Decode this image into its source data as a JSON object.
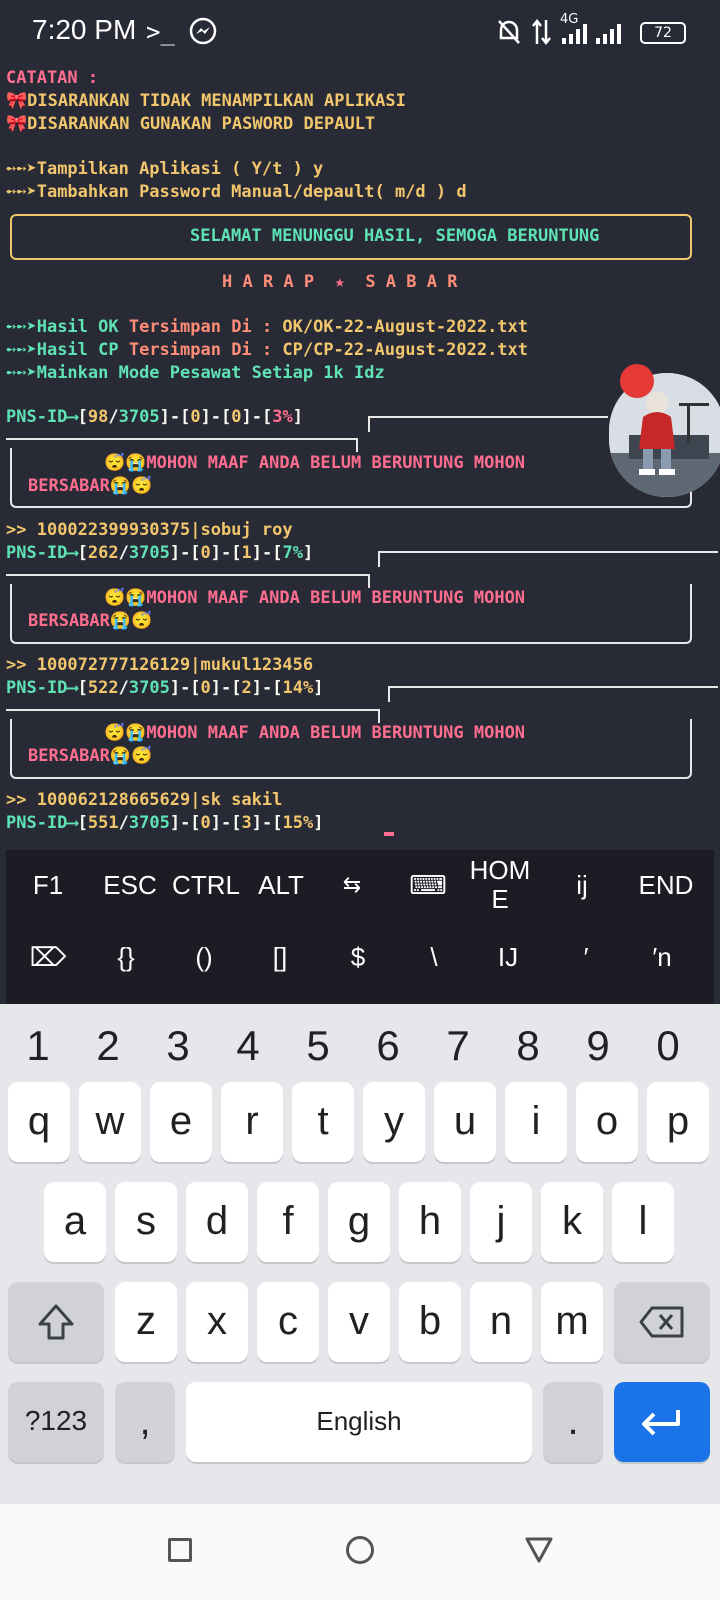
{
  "status_bar": {
    "time": "7:20 PM",
    "network_label": "4G",
    "battery": "72"
  },
  "terminal": {
    "catatan": "CATATAN :",
    "note1": "DISARANKAN TIDAK MENAMPILKAN APLIKASI",
    "note2": "DISARANKAN GUNAKAN PASWORD DEPAULT",
    "prompt1": "Tampilkan Aplikasi ( Y/t ) y",
    "prompt2": "Tambahkan Password Manual/depault( m/d ) d",
    "banner": "SELAMAT MENUNGGU HASIL, SEMOGA BERUNTUNG",
    "harap": "H A R A P  ",
    "sabar": "  S A B A R",
    "ok_label": "Hasil OK ",
    "ok_mid": "Tersimpan Di : ",
    "ok_file": "OK/OK-22-August-2022.txt",
    "cp_label": "Hasil CP ",
    "cp_mid": "Tersimpan Di : ",
    "cp_file": "CP/CP-22-August-2022.txt",
    "mode": "Mainkan Mode Pesawat Setiap 1k Idz",
    "sorry1": "MOHON MAAF ANDA BELUM BERUNTUNG MOHON",
    "sorry2": "BERSABAR",
    "entries": [
      {
        "progress_a": "98",
        "total": "3705",
        "ok": "0",
        "cp": "0",
        "pct": "3%"
      },
      {
        "account": "100022399930375|sobuj roy",
        "progress_a": "262",
        "total": "3705",
        "ok": "0",
        "cp": "1",
        "pct": "7%"
      },
      {
        "account": "100072777126129|mukul123456",
        "progress_a": "522",
        "total": "3705",
        "ok": "0",
        "cp": "2",
        "pct": "14%"
      },
      {
        "account": "100062128665629|sk sakil",
        "progress_a": "551",
        "total": "3705",
        "ok": "0",
        "cp": "3",
        "pct": "15%"
      }
    ]
  },
  "extra_keys": {
    "row1": [
      "F1",
      "ESC",
      "CTRL",
      "ALT",
      "⇆",
      "⌨",
      "HOME",
      "ij",
      "END"
    ],
    "row2": [
      "⌦",
      "{}",
      "()",
      "[]",
      "$",
      "\\",
      "IJ",
      "′",
      "′n"
    ]
  },
  "keyboard": {
    "numbers": [
      "1",
      "2",
      "3",
      "4",
      "5",
      "6",
      "7",
      "8",
      "9",
      "0"
    ],
    "row1": [
      "q",
      "w",
      "e",
      "r",
      "t",
      "y",
      "u",
      "i",
      "o",
      "p"
    ],
    "row2": [
      "a",
      "s",
      "d",
      "f",
      "g",
      "h",
      "j",
      "k",
      "l"
    ],
    "row3": [
      "z",
      "x",
      "c",
      "v",
      "b",
      "n",
      "m"
    ],
    "symbols_key": "?123",
    "comma_key": ",",
    "space_label": "English",
    "period_key": "."
  }
}
